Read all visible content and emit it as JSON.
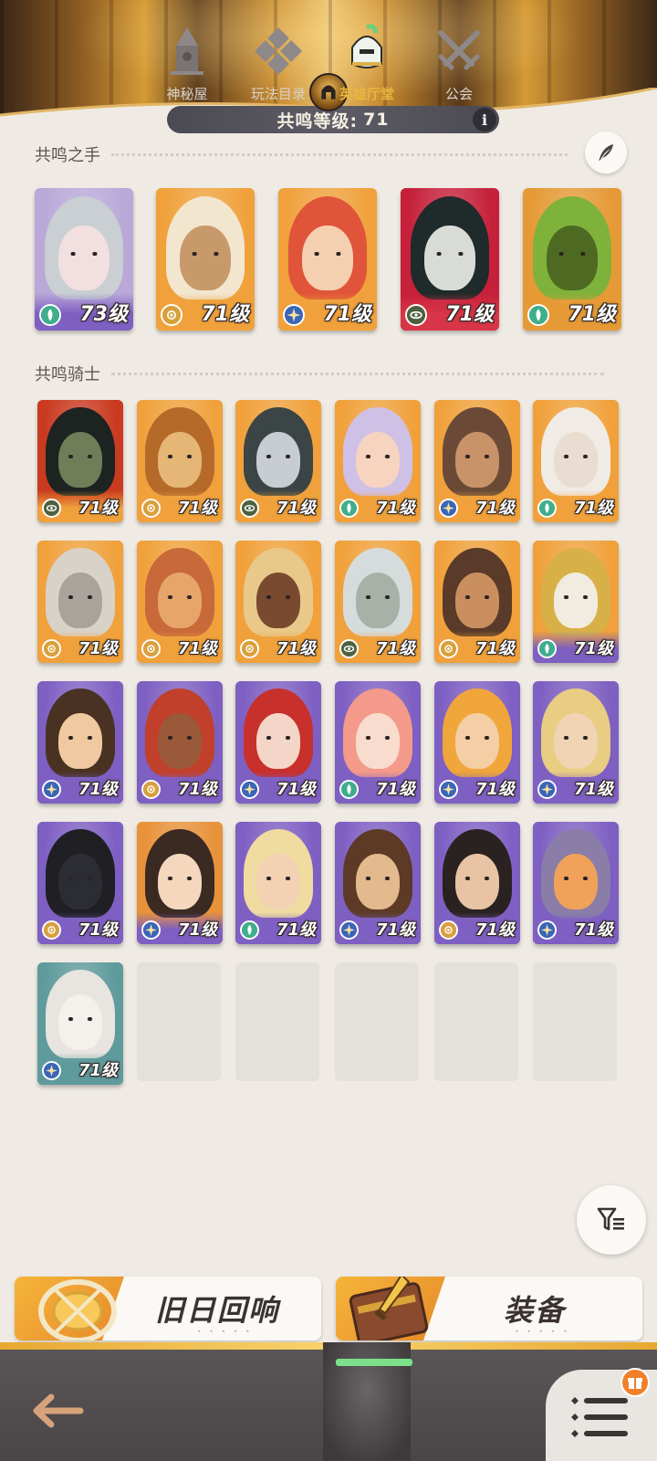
{
  "header": {
    "level_label": "共鸣等级:",
    "level_value": "71",
    "info_symbol": "i"
  },
  "resonance_hand": {
    "title": "共鸣之手",
    "heroes": [
      {
        "level": "73级",
        "faction": "forest",
        "colors": {
          "bg": "#b9a8d8",
          "strip": "#7e5fc2",
          "hair": "#c9cfd3",
          "skin": "#f2dfe0"
        }
      },
      {
        "level": "71级",
        "faction": "lightbearer",
        "colors": {
          "bg": "#f0a13b",
          "strip": "#f0a13b",
          "hair": "#f3e6cf",
          "skin": "#c89a6b"
        }
      },
      {
        "level": "71级",
        "faction": "celestial",
        "colors": {
          "bg": "#f0a13b",
          "strip": "#f0a13b",
          "hair": "#e0553a",
          "skin": "#f5d0b0"
        }
      },
      {
        "level": "71级",
        "faction": "graveborn",
        "colors": {
          "bg": "#c6203a",
          "strip": "#d83548",
          "hair": "#1f2a2a",
          "skin": "#d9dcd6"
        }
      },
      {
        "level": "71级",
        "faction": "forest",
        "colors": {
          "bg": "#e59a35",
          "strip": "#e59a35",
          "hair": "#7fb23a",
          "skin": "#4e6a22"
        }
      }
    ]
  },
  "resonance_knights": {
    "title": "共鸣骑士",
    "heroes": [
      {
        "level": "71级",
        "faction": "graveborn",
        "colors": {
          "bg": "#c93a20",
          "strip": "#f0a13b",
          "hair": "#1c2320",
          "skin": "#6f7d58"
        }
      },
      {
        "level": "71级",
        "faction": "lightbearer",
        "colors": {
          "bg": "#f0a13b",
          "strip": "#f0a13b",
          "hair": "#b56a2a",
          "skin": "#e6b676"
        }
      },
      {
        "level": "71级",
        "faction": "graveborn",
        "colors": {
          "bg": "#f0a13b",
          "strip": "#f0a13b",
          "hair": "#3c4545",
          "skin": "#c8cdd3"
        }
      },
      {
        "level": "71级",
        "faction": "forest",
        "colors": {
          "bg": "#f0a13b",
          "strip": "#f0a13b",
          "hair": "#cfc0e6",
          "skin": "#f6d4c0"
        }
      },
      {
        "level": "71级",
        "faction": "celestial",
        "colors": {
          "bg": "#f0a13b",
          "strip": "#f0a13b",
          "hair": "#6a4a36",
          "skin": "#c9936a"
        }
      },
      {
        "level": "71级",
        "faction": "forest",
        "colors": {
          "bg": "#f0a13b",
          "strip": "#f0a13b",
          "hair": "#f1ebe6",
          "skin": "#e9dcd0"
        }
      },
      {
        "level": "71级",
        "faction": "lightbearer",
        "colors": {
          "bg": "#f0a13b",
          "strip": "#f0a13b",
          "hair": "#d8d2c8",
          "skin": "#a8a39b"
        }
      },
      {
        "level": "71级",
        "faction": "lightbearer",
        "colors": {
          "bg": "#f0a13b",
          "strip": "#f0a13b",
          "hair": "#c8693a",
          "skin": "#e8a56a"
        }
      },
      {
        "level": "71级",
        "faction": "lightbearer",
        "colors": {
          "bg": "#f0a13b",
          "strip": "#f0a13b",
          "hair": "#e9c98a",
          "skin": "#7a4a30"
        }
      },
      {
        "level": "71级",
        "faction": "graveborn",
        "colors": {
          "bg": "#f0a13b",
          "strip": "#f0a13b",
          "hair": "#d6dcdc",
          "skin": "#a7b1a8"
        }
      },
      {
        "level": "71级",
        "faction": "lightbearer",
        "colors": {
          "bg": "#f0a13b",
          "strip": "#f0a13b",
          "hair": "#5a3a28",
          "skin": "#c98f5e"
        }
      },
      {
        "level": "71级",
        "faction": "forest",
        "colors": {
          "bg": "#f0a13b",
          "strip": "#7e5fc2",
          "hair": "#d8b048",
          "skin": "#f2ebe0"
        }
      },
      {
        "level": "71级",
        "faction": "celestial",
        "colors": {
          "bg": "#7e5fc2",
          "strip": "#7e5fc2",
          "hair": "#4a3222",
          "skin": "#f0c9a0"
        }
      },
      {
        "level": "71级",
        "faction": "lightbearer",
        "colors": {
          "bg": "#7e5fc2",
          "strip": "#7e5fc2",
          "hair": "#c0402c",
          "skin": "#9a5a3a"
        }
      },
      {
        "level": "71级",
        "faction": "celestial",
        "colors": {
          "bg": "#7e5fc2",
          "strip": "#7e5fc2",
          "hair": "#c8302c",
          "skin": "#f3d6c7"
        }
      },
      {
        "level": "71级",
        "faction": "forest",
        "colors": {
          "bg": "#7e5fc2",
          "strip": "#7e5fc2",
          "hair": "#f39a8a",
          "skin": "#f8dccd"
        }
      },
      {
        "level": "71级",
        "faction": "celestial",
        "colors": {
          "bg": "#7e5fc2",
          "strip": "#7e5fc2",
          "hair": "#f0a63a",
          "skin": "#f4cfa5"
        }
      },
      {
        "level": "71级",
        "faction": "celestial",
        "colors": {
          "bg": "#7e5fc2",
          "strip": "#7e5fc2",
          "hair": "#e8cd82",
          "skin": "#f0d4b4"
        }
      },
      {
        "level": "71级",
        "faction": "lightbearer",
        "colors": {
          "bg": "#7e5fc2",
          "strip": "#7e5fc2",
          "hair": "#1f1f24",
          "skin": "#2c2c34"
        }
      },
      {
        "level": "71级",
        "faction": "celestial",
        "colors": {
          "bg": "#e8923a",
          "strip": "#7e5fc2",
          "hair": "#3a2a22",
          "skin": "#f4d7bd"
        }
      },
      {
        "level": "71级",
        "faction": "forest",
        "colors": {
          "bg": "#7e5fc2",
          "strip": "#7e5fc2",
          "hair": "#f0dba0",
          "skin": "#f3d2b4"
        }
      },
      {
        "level": "71级",
        "faction": "celestial",
        "colors": {
          "bg": "#7e5fc2",
          "strip": "#7e5fc2",
          "hair": "#5c3a26",
          "skin": "#e3b98e"
        }
      },
      {
        "level": "71级",
        "faction": "lightbearer",
        "colors": {
          "bg": "#7e5fc2",
          "strip": "#7e5fc2",
          "hair": "#2a2220",
          "skin": "#e8c4a4"
        }
      },
      {
        "level": "71级",
        "faction": "celestial",
        "colors": {
          "bg": "#7e5fc2",
          "strip": "#7e5fc2",
          "hair": "#8a7ea8",
          "skin": "#f0a25a"
        }
      },
      {
        "level": "71级",
        "faction": "celestial",
        "colors": {
          "bg": "#5f9a9c",
          "strip": "#5f9a9c",
          "hair": "#e8e4e0",
          "skin": "#f4f0ec"
        }
      }
    ],
    "empty_slots": 5
  },
  "buttons": {
    "echoes_label": "旧日回响",
    "equipment_label": "装备"
  },
  "nav": {
    "items": [
      {
        "label": "神秘屋"
      },
      {
        "label": "玩法目录"
      },
      {
        "label": "英雄厅堂"
      },
      {
        "label": "公会"
      }
    ]
  },
  "faction_colors": {
    "forest": "#3fae8c",
    "lightbearer": "#d8a03c",
    "celestial": "#3a66b8",
    "graveborn": "#4d6140"
  }
}
